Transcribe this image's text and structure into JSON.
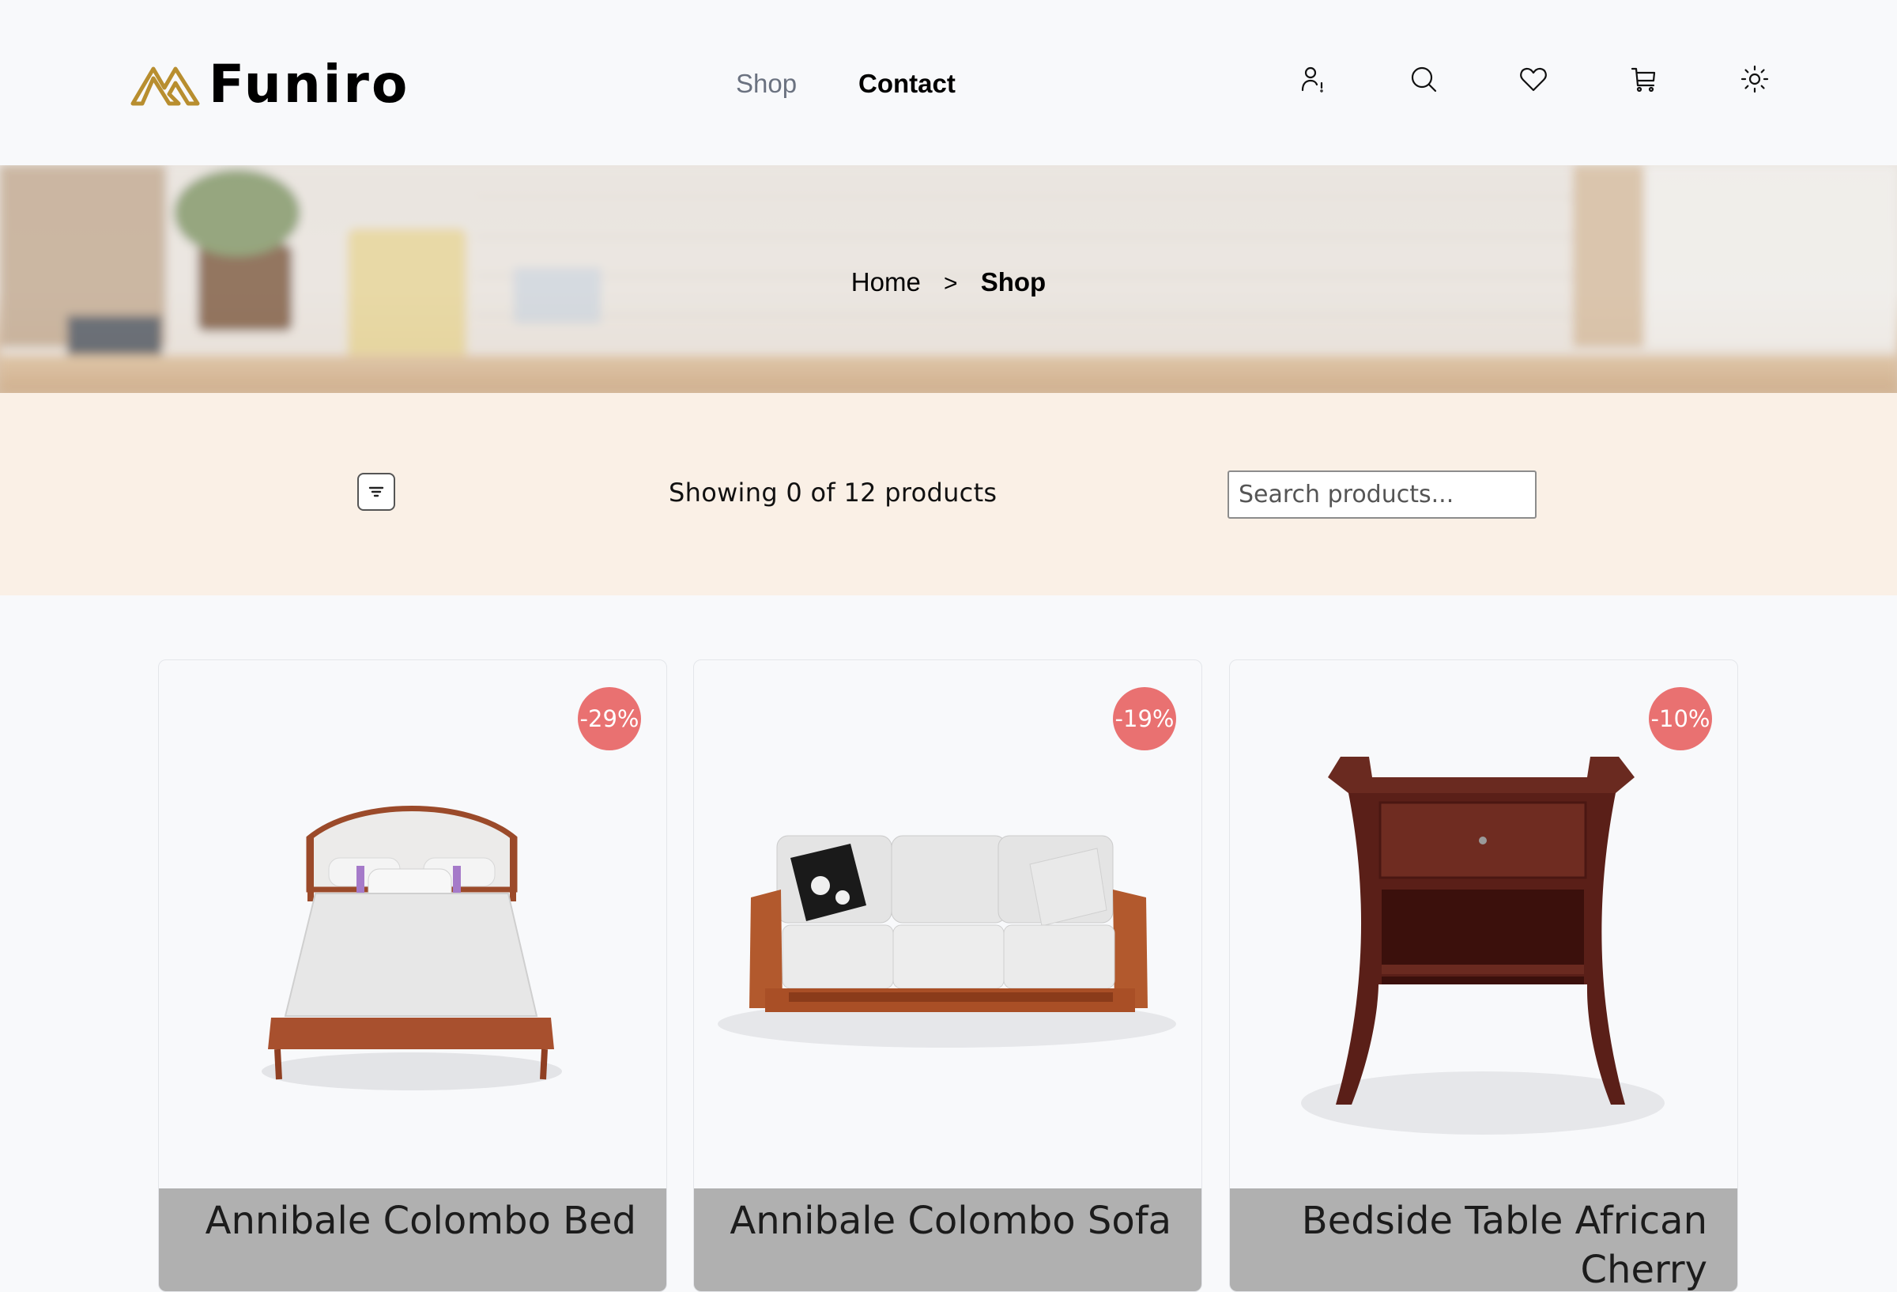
{
  "header": {
    "brand": "Funiro",
    "nav": {
      "shop": "Shop",
      "contact": "Contact"
    },
    "icons": [
      "account-alert-icon",
      "search-icon",
      "heart-icon",
      "cart-icon",
      "sun-icon"
    ],
    "brand_color": "#b88e2f"
  },
  "banner": {
    "breadcrumb": {
      "home": "Home",
      "separator": ">",
      "current": "Shop"
    }
  },
  "filterbar": {
    "results": "Showing 0 of 12 products",
    "search_placeholder": "Search products..."
  },
  "products": [
    {
      "name": "Annibale Colombo Bed",
      "discount": "-29%"
    },
    {
      "name": "Annibale Colombo Sofa",
      "discount": "-19%"
    },
    {
      "name": "Bedside Table African Cherry",
      "discount": "-10%"
    }
  ],
  "colors": {
    "discount_badge": "#e97171",
    "filterbar_bg": "#faf0e6",
    "card_footer": "#b0b0b0"
  }
}
